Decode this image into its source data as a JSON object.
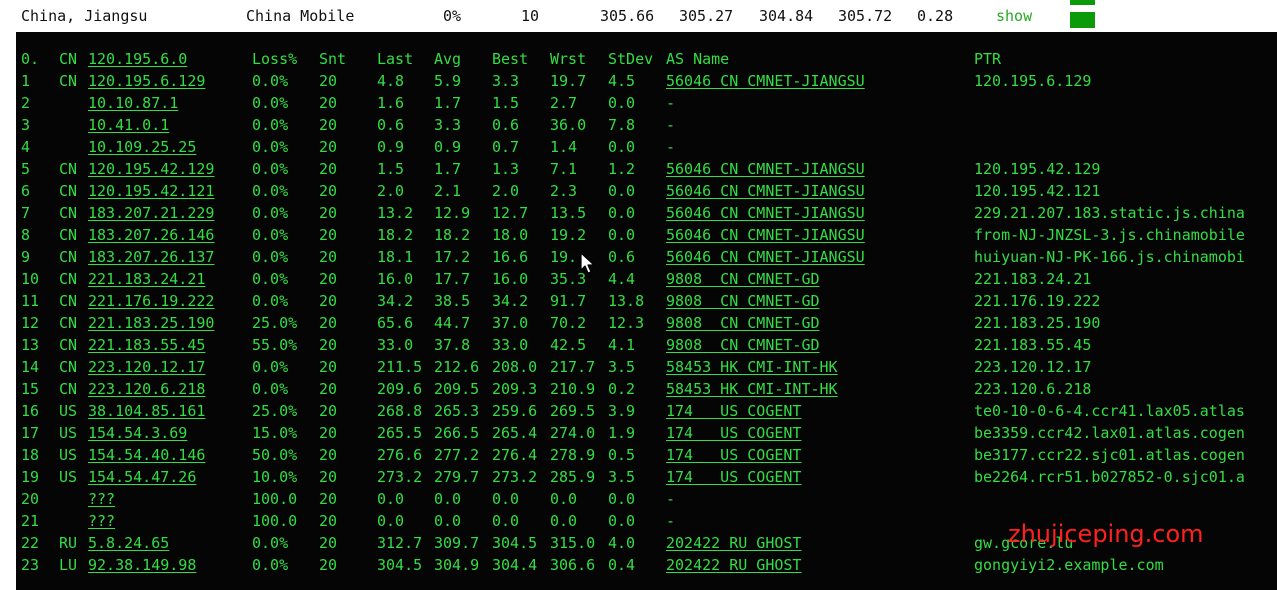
{
  "summary": {
    "location": "China, Jiangsu",
    "isp": "China Mobile",
    "loss": "0%",
    "sent": "10",
    "last": "305.66",
    "avg": "305.27",
    "best": "304.84",
    "worst": "305.72",
    "stdev": "0.28",
    "show_label": "show",
    "accent_color": "#0a9a0a"
  },
  "terminal": {
    "headers": {
      "hop": "0.",
      "cc": "CN",
      "host": "120.195.6.0",
      "loss": "Loss%",
      "snt": "Snt",
      "last": "Last",
      "avg": "Avg",
      "best": "Best",
      "wrst": "Wrst",
      "stdev": "StDev",
      "asname": "AS Name",
      "ptr": "PTR"
    },
    "rows": [
      {
        "hop": "1",
        "cc": "CN",
        "host": "120.195.6.129",
        "loss": "0.0%",
        "snt": "20",
        "last": "4.8",
        "avg": "5.9",
        "best": "3.3",
        "wrst": "19.7",
        "stdev": "4.5",
        "asname": "56046 CN CMNET-JIANGSU",
        "ptr": "120.195.6.129"
      },
      {
        "hop": "2",
        "cc": "",
        "host": "10.10.87.1",
        "loss": "0.0%",
        "snt": "20",
        "last": "1.6",
        "avg": "1.7",
        "best": "1.5",
        "wrst": "2.7",
        "stdev": "0.0",
        "asname": "-",
        "ptr": ""
      },
      {
        "hop": "3",
        "cc": "",
        "host": "10.41.0.1",
        "loss": "0.0%",
        "snt": "20",
        "last": "0.6",
        "avg": "3.3",
        "best": "0.6",
        "wrst": "36.0",
        "stdev": "7.8",
        "asname": "-",
        "ptr": ""
      },
      {
        "hop": "4",
        "cc": "",
        "host": "10.109.25.25",
        "loss": "0.0%",
        "snt": "20",
        "last": "0.9",
        "avg": "0.9",
        "best": "0.7",
        "wrst": "1.4",
        "stdev": "0.0",
        "asname": "-",
        "ptr": ""
      },
      {
        "hop": "5",
        "cc": "CN",
        "host": "120.195.42.129",
        "loss": "0.0%",
        "snt": "20",
        "last": "1.5",
        "avg": "1.7",
        "best": "1.3",
        "wrst": "7.1",
        "stdev": "1.2",
        "asname": "56046 CN CMNET-JIANGSU",
        "ptr": "120.195.42.129"
      },
      {
        "hop": "6",
        "cc": "CN",
        "host": "120.195.42.121",
        "loss": "0.0%",
        "snt": "20",
        "last": "2.0",
        "avg": "2.1",
        "best": "2.0",
        "wrst": "2.3",
        "stdev": "0.0",
        "asname": "56046 CN CMNET-JIANGSU",
        "ptr": "120.195.42.121"
      },
      {
        "hop": "7",
        "cc": "CN",
        "host": "183.207.21.229",
        "loss": "0.0%",
        "snt": "20",
        "last": "13.2",
        "avg": "12.9",
        "best": "12.7",
        "wrst": "13.5",
        "stdev": "0.0",
        "asname": "56046 CN CMNET-JIANGSU",
        "ptr": "229.21.207.183.static.js.china"
      },
      {
        "hop": "8",
        "cc": "CN",
        "host": "183.207.26.146",
        "loss": "0.0%",
        "snt": "20",
        "last": "18.2",
        "avg": "18.2",
        "best": "18.0",
        "wrst": "19.2",
        "stdev": "0.0",
        "asname": "56046 CN CMNET-JIANGSU",
        "ptr": "from-NJ-JNZSL-3.js.chinamobile"
      },
      {
        "hop": "9",
        "cc": "CN",
        "host": "183.207.26.137",
        "loss": "0.0%",
        "snt": "20",
        "last": "18.1",
        "avg": "17.2",
        "best": "16.6",
        "wrst": "19.",
        "stdev": "0.6",
        "asname": "56046 CN CMNET-JIANGSU",
        "ptr": "huiyuan-NJ-PK-166.js.chinamobi"
      },
      {
        "hop": "10",
        "cc": "CN",
        "host": "221.183.24.21",
        "loss": "0.0%",
        "snt": "20",
        "last": "16.0",
        "avg": "17.7",
        "best": "16.0",
        "wrst": "35.3",
        "stdev": "4.4",
        "asname": "9808  CN CMNET-GD",
        "ptr": "221.183.24.21"
      },
      {
        "hop": "11",
        "cc": "CN",
        "host": "221.176.19.222",
        "loss": "0.0%",
        "snt": "20",
        "last": "34.2",
        "avg": "38.5",
        "best": "34.2",
        "wrst": "91.7",
        "stdev": "13.8",
        "asname": "9808  CN CMNET-GD",
        "ptr": "221.176.19.222"
      },
      {
        "hop": "12",
        "cc": "CN",
        "host": "221.183.25.190",
        "loss": "25.0%",
        "snt": "20",
        "last": "65.6",
        "avg": "44.7",
        "best": "37.0",
        "wrst": "70.2",
        "stdev": "12.3",
        "asname": "9808  CN CMNET-GD",
        "ptr": "221.183.25.190"
      },
      {
        "hop": "13",
        "cc": "CN",
        "host": "221.183.55.45",
        "loss": "55.0%",
        "snt": "20",
        "last": "33.0",
        "avg": "37.8",
        "best": "33.0",
        "wrst": "42.5",
        "stdev": "4.1",
        "asname": "9808  CN CMNET-GD",
        "ptr": "221.183.55.45"
      },
      {
        "hop": "14",
        "cc": "CN",
        "host": "223.120.12.17",
        "loss": "0.0%",
        "snt": "20",
        "last": "211.5",
        "avg": "212.6",
        "best": "208.0",
        "wrst": "217.7",
        "stdev": "3.5",
        "asname": "58453 HK CMI-INT-HK",
        "ptr": "223.120.12.17"
      },
      {
        "hop": "15",
        "cc": "CN",
        "host": "223.120.6.218",
        "loss": "0.0%",
        "snt": "20",
        "last": "209.6",
        "avg": "209.5",
        "best": "209.3",
        "wrst": "210.9",
        "stdev": "0.2",
        "asname": "58453 HK CMI-INT-HK",
        "ptr": "223.120.6.218"
      },
      {
        "hop": "16",
        "cc": "US",
        "host": "38.104.85.161",
        "loss": "25.0%",
        "snt": "20",
        "last": "268.8",
        "avg": "265.3",
        "best": "259.6",
        "wrst": "269.5",
        "stdev": "3.9",
        "asname": "174   US COGENT",
        "ptr": "te0-10-0-6-4.ccr41.lax05.atlas"
      },
      {
        "hop": "17",
        "cc": "US",
        "host": "154.54.3.69",
        "loss": "15.0%",
        "snt": "20",
        "last": "265.5",
        "avg": "266.5",
        "best": "265.4",
        "wrst": "274.0",
        "stdev": "1.9",
        "asname": "174   US COGENT",
        "ptr": "be3359.ccr42.lax01.atlas.cogen"
      },
      {
        "hop": "18",
        "cc": "US",
        "host": "154.54.40.146",
        "loss": "50.0%",
        "snt": "20",
        "last": "276.6",
        "avg": "277.2",
        "best": "276.4",
        "wrst": "278.9",
        "stdev": "0.5",
        "asname": "174   US COGENT",
        "ptr": "be3177.ccr22.sjc01.atlas.cogen"
      },
      {
        "hop": "19",
        "cc": "US",
        "host": "154.54.47.26",
        "loss": "10.0%",
        "snt": "20",
        "last": "273.2",
        "avg": "279.7",
        "best": "273.2",
        "wrst": "285.9",
        "stdev": "3.5",
        "asname": "174   US COGENT",
        "ptr": "be2264.rcr51.b027852-0.sjc01.a"
      },
      {
        "hop": "20",
        "cc": "",
        "host": "???",
        "loss": "100.0",
        "snt": "20",
        "last": "0.0",
        "avg": "0.0",
        "best": "0.0",
        "wrst": "0.0",
        "stdev": "0.0",
        "asname": "-",
        "ptr": ""
      },
      {
        "hop": "21",
        "cc": "",
        "host": "???",
        "loss": "100.0",
        "snt": "20",
        "last": "0.0",
        "avg": "0.0",
        "best": "0.0",
        "wrst": "0.0",
        "stdev": "0.0",
        "asname": "-",
        "ptr": ""
      },
      {
        "hop": "22",
        "cc": "RU",
        "host": "5.8.24.65",
        "loss": "0.0%",
        "snt": "20",
        "last": "312.7",
        "avg": "309.7",
        "best": "304.5",
        "wrst": "315.0",
        "stdev": "4.0",
        "asname": "202422 RU GHOST",
        "ptr": "gw.gcore.lu"
      },
      {
        "hop": "23",
        "cc": "LU",
        "host": "92.38.149.98",
        "loss": "0.0%",
        "snt": "20",
        "last": "304.5",
        "avg": "304.9",
        "best": "304.4",
        "wrst": "306.6",
        "stdev": "0.4",
        "asname": "202422 RU GHOST",
        "ptr": "gongyiyi2.example.com"
      }
    ]
  },
  "watermark": "zhujiceping.com",
  "cursor_icon": "mouse-pointer-icon",
  "colors": {
    "terminal_bg": "#050505",
    "terminal_text": "#33dd44",
    "watermark": "#ff2020"
  }
}
